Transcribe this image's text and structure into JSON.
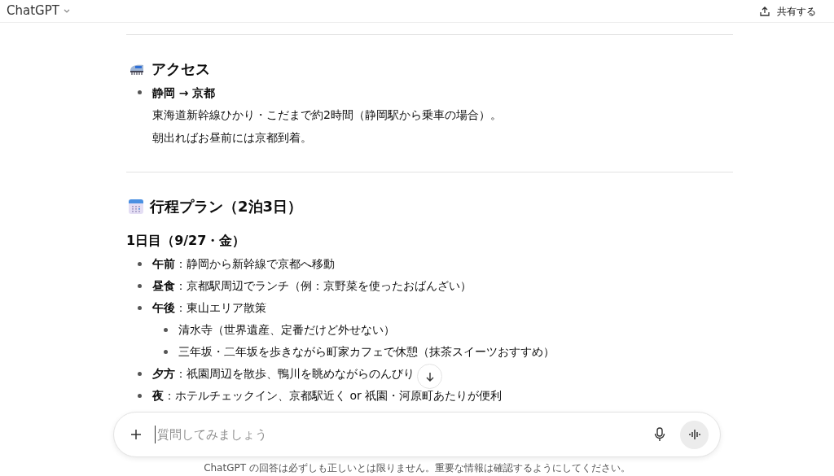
{
  "header": {
    "title": "ChatGPT",
    "share_label": "共有する"
  },
  "sections": [
    {
      "heading": "アクセス",
      "items": [
        {
          "title": "静岡 → 京都",
          "lines": [
            "東海道新幹線ひかり・こだまで約2時間（静岡駅から乗車の場合）。",
            "朝出ればお昼前には京都到着。"
          ]
        }
      ]
    },
    {
      "heading": "行程プラン（2泊3日）",
      "subheading": "1日目（9/27・金）",
      "bullets": [
        {
          "text": "**午前**：静岡から新幹線で京都へ移動"
        },
        {
          "text": "**昼食**：京都駅周辺でランチ（例：京野菜を使ったおばんざい）"
        },
        {
          "text": "**午後**：東山エリア散策",
          "children": [
            {
              "text": "清水寺（世界遺産、定番だけど外せない）"
            },
            {
              "text": "三年坂・二年坂を歩きながら町家カフェで休憩（抹茶スイーツおすすめ）"
            }
          ]
        },
        {
          "text": "**夕方**：祇園周辺を散歩、鴨川を眺めながらのんびり"
        },
        {
          "text": "**夜**：ホテルチェックイン、京都駅近く or 祇園・河原町あたりが便利"
        }
      ]
    }
  ],
  "composer": {
    "placeholder": "質問してみましょう"
  },
  "disclaimer": "ChatGPT の回答は必ずしも正しいとは限りません。重要な情報は確認するようにしてください。"
}
